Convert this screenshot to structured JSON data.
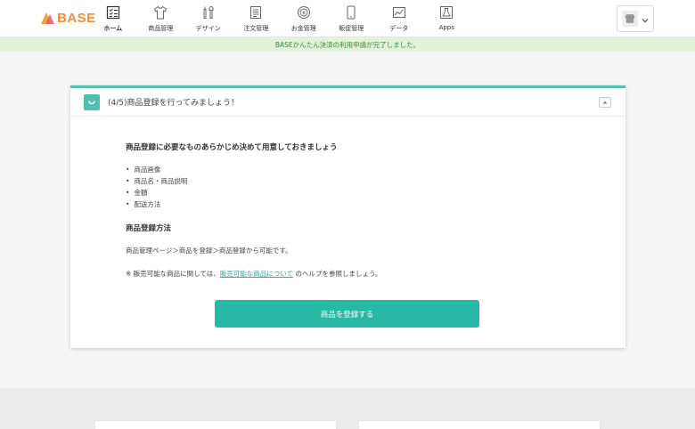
{
  "header": {
    "logo_text": "BASE",
    "nav": [
      {
        "label": "ホーム",
        "icon": "home-checklist-icon",
        "active": true
      },
      {
        "label": "商品管理",
        "icon": "tshirt-icon"
      },
      {
        "label": "デザイン",
        "icon": "design-tools-icon"
      },
      {
        "label": "注文管理",
        "icon": "order-document-icon"
      },
      {
        "label": "お金管理",
        "icon": "coin-icon"
      },
      {
        "label": "販促管理",
        "icon": "smartphone-icon"
      },
      {
        "label": "データ",
        "icon": "line-chart-icon"
      },
      {
        "label": "Apps",
        "icon": "apps-flask-icon"
      }
    ],
    "shop_switch_icon": "shop-icon"
  },
  "notice": {
    "text": "BASEかんたん決済の利用申請が完了しました。"
  },
  "card": {
    "title": "(4/5)商品登録を行ってみましょう！",
    "section1_title": "商品登録に必要なものあらかじめ決めて用意しておきましょう",
    "items": [
      "商品画像",
      "商品名・商品説明",
      "金額",
      "配送方法"
    ],
    "section2_title": "商品登録方法",
    "method_text": "商品管理ページ＞商品を登録＞商品登録から可能です。",
    "note_prefix": "※ 販売可能な商品に関しては、",
    "note_link": "販売可能な商品について",
    "note_suffix": " のヘルプを参照しましょう。",
    "button_label": "商品を登録する"
  },
  "colors": {
    "accent": "#29b8a5",
    "notice_bg": "#e3f2dd",
    "notice_text": "#3a8a3a",
    "logo": "#f08d3a"
  }
}
